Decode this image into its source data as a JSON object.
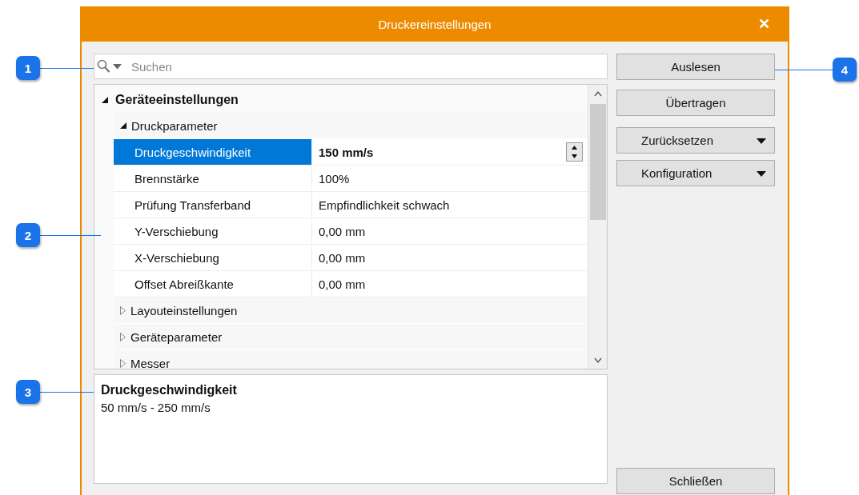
{
  "window": {
    "title": "Druckereinstellungen",
    "close": "✕"
  },
  "search": {
    "placeholder": "Suchen"
  },
  "tree": [
    {
      "label": "Geräteeinstellungen",
      "expanded": true,
      "children": [
        {
          "label": "Druckparameter",
          "expanded": true,
          "properties": [
            {
              "name": "Druckgeschwindigkeit",
              "value": "150  mm/s",
              "selected": true,
              "editing": true
            },
            {
              "name": "Brennstärke",
              "value": "100%",
              "selected": false,
              "editing": false
            },
            {
              "name": "Prüfung Transferband",
              "value": "Empfindlichkeit schwach",
              "selected": false,
              "editing": false
            },
            {
              "name": "Y-Verschiebung",
              "value": "0,00  mm",
              "selected": false,
              "editing": false
            },
            {
              "name": "X-Verschiebung",
              "value": "0,00  mm",
              "selected": false,
              "editing": false
            },
            {
              "name": "Offset Abreißkante",
              "value": "0,00  mm",
              "selected": false,
              "editing": false
            }
          ]
        },
        {
          "label": "Layouteinstellungen",
          "expanded": false
        },
        {
          "label": "Geräteparameter",
          "expanded": false
        },
        {
          "label": "Messer",
          "expanded": false
        }
      ]
    }
  ],
  "description": {
    "title": "Druckgeschwindigkeit",
    "text": "50  mm/s - 250  mm/s"
  },
  "buttons": [
    {
      "label": "Auslesen",
      "kind": "button"
    },
    {
      "label": "Übertragen",
      "kind": "button"
    },
    {
      "label": "Zurücksetzen",
      "kind": "dropdown"
    },
    {
      "label": "Konfiguration",
      "kind": "dropdown"
    }
  ],
  "close_button": {
    "label": "Schließen"
  },
  "callouts": [
    {
      "number": "1"
    },
    {
      "number": "2"
    },
    {
      "number": "3"
    },
    {
      "number": "4"
    }
  ]
}
